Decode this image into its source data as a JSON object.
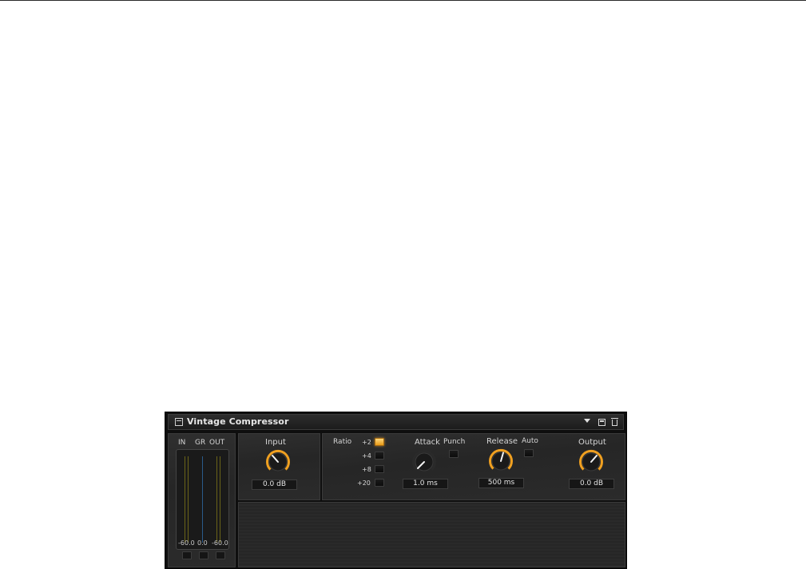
{
  "plugin": {
    "title": "Vintage Compressor",
    "accent_color": "#f0a020"
  },
  "titlebar_icons": {
    "menu": "panel-menu-icon",
    "dropdown": "dropdown-arrow-icon",
    "save": "save-icon",
    "delete": "trash-icon"
  },
  "meters": {
    "in_label": "IN",
    "gr_label": "GR",
    "out_label": "OUT",
    "in_value": "-60.0",
    "gr_value": "0.0",
    "out_value": "-60.0"
  },
  "input": {
    "label": "Input",
    "value": "0.0 dB"
  },
  "ratio": {
    "label": "Ratio",
    "options": [
      "+2",
      "+4",
      "+8",
      "+20"
    ],
    "selected": "+2"
  },
  "attack": {
    "label": "Attack",
    "value": "1.0 ms"
  },
  "punch": {
    "label": "Punch"
  },
  "release": {
    "label": "Release",
    "value": "500 ms"
  },
  "auto": {
    "label": "Auto"
  },
  "output": {
    "label": "Output",
    "value": "0.0 dB"
  }
}
